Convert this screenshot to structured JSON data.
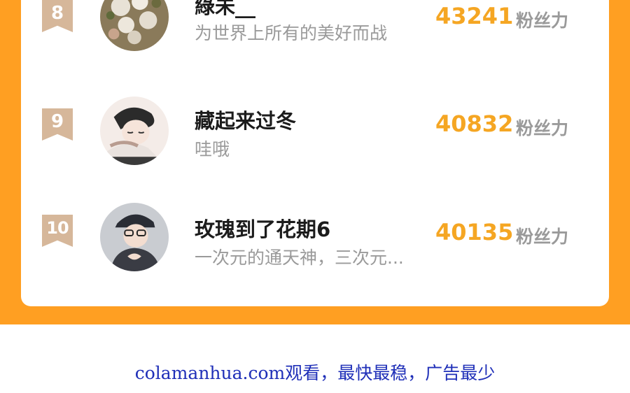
{
  "ranking": [
    {
      "rank": "8",
      "name": "綠未__",
      "bio": "为世界上所有的美好而战",
      "fans": "43241",
      "fans_unit": "粉丝力",
      "avatar_icon": "avatar-flowers-icon"
    },
    {
      "rank": "9",
      "name": "藏起来过冬",
      "bio": "哇哦",
      "fans": "40832",
      "fans_unit": "粉丝力",
      "avatar_icon": "avatar-sleeping-boy-icon"
    },
    {
      "rank": "10",
      "name": "玫瑰到了花期6",
      "bio": "一次元的通天神，三次元...",
      "fans": "40135",
      "fans_unit": "粉丝力",
      "avatar_icon": "avatar-boy-cap-icon"
    }
  ],
  "footer": {
    "text": "colamanhua.com观看，最快最稳，广告最少"
  },
  "colors": {
    "frame": "#ff9f22",
    "fans": "#f5a623",
    "badge": "#d6b79a",
    "footer_link": "#1f2fb8"
  }
}
